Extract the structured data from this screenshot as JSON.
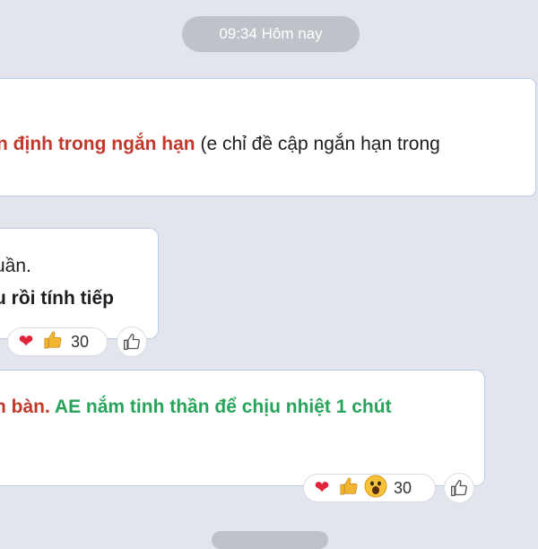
{
  "timestamp": "09:34 Hôm nay",
  "messages": [
    {
      "segments": {
        "red": "n định trong ngắn hạn",
        "plain": " (e chỉ đề cập ngắn hạn trong"
      }
    },
    {
      "line1": "uần.",
      "line2": "u rồi tính tiếp",
      "reactions": {
        "icons": [
          "heart-emoji",
          "thumbs-up-emoji"
        ],
        "count": "30"
      }
    },
    {
      "segments": {
        "red": "n bàn.",
        "green": " AE nắm tinh thần để chịu nhiệt 1 chút"
      },
      "reactions": {
        "icons": [
          "heart-emoji",
          "thumbs-up-emoji",
          "wow-emoji"
        ],
        "count": "30"
      }
    }
  ],
  "colors": {
    "background": "#e2e5eb",
    "highlight_red": "#c0392b",
    "highlight_green": "#27a35a",
    "bubble_border": "#b9cde9"
  }
}
